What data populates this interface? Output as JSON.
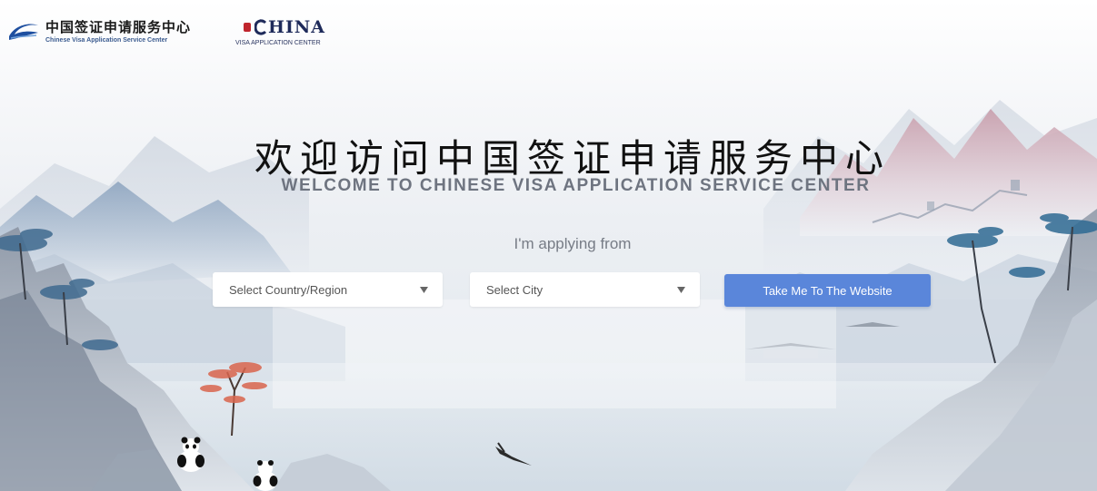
{
  "header": {
    "logo_cn": "中国签证申请服务中心",
    "logo_en": "Chinese Visa Application Service Center",
    "china_logo_word": "HINA",
    "china_logo_sub": "VISA APPLICATION CENTER"
  },
  "hero": {
    "title_cn": "欢迎访问中国签证申请服务中心",
    "title_en": "WELCOME TO CHINESE VISA APPLICATION SERVICE CENTER",
    "applying_label": "I'm applying from"
  },
  "form": {
    "country_select": {
      "value": "Select Country/Region"
    },
    "city_select": {
      "value": "Select City"
    },
    "submit_label": "Take Me To The Website"
  },
  "colors": {
    "button": "#5a86da",
    "title_en": "#6e7480",
    "logo_blue": "#1e4fa0",
    "seal_red": "#c0252d"
  },
  "icons": [
    "swoosh-logo-icon",
    "chevron-down-icon",
    "chevron-down-icon"
  ]
}
